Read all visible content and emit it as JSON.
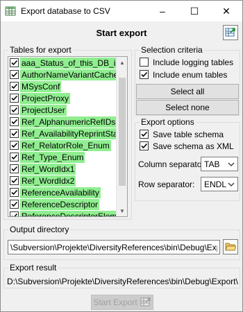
{
  "window": {
    "title": "Export database to CSV",
    "minimize_glyph": "–",
    "maximize_glyph": "☐",
    "close_glyph": "✕"
  },
  "heading": "Start export",
  "tables_group": {
    "legend": "Tables for export",
    "items": [
      {
        "label": "aaa_Status_of_this_DB_is_P",
        "checked": true
      },
      {
        "label": "AuthorNameVariantCache",
        "checked": true
      },
      {
        "label": "MSysConf",
        "checked": true
      },
      {
        "label": "ProjectProxy",
        "checked": true
      },
      {
        "label": "ProjectUser",
        "checked": true
      },
      {
        "label": "Ref_AlphanumericRefIDsFrom",
        "checked": true
      },
      {
        "label": "Ref_AvailabilityReprintStatus",
        "checked": true
      },
      {
        "label": "Ref_RelatorRole_Enum",
        "checked": true
      },
      {
        "label": "Ref_Type_Enum",
        "checked": true
      },
      {
        "label": "Ref_WordIdx1",
        "checked": true
      },
      {
        "label": "Ref_WordIdx2",
        "checked": true
      },
      {
        "label": "ReferenceAvailability",
        "checked": true
      },
      {
        "label": "ReferenceDescriptor",
        "checked": true
      },
      {
        "label": "ReferenceDescriptorElement",
        "checked": true
      }
    ]
  },
  "criteria_group": {
    "legend": "Selection criteria",
    "include_logging_label": "Include logging tables",
    "include_logging_checked": false,
    "include_enum_label": "Include enum tables",
    "include_enum_checked": true,
    "select_all_label": "Select all",
    "select_none_label": "Select none"
  },
  "options_group": {
    "legend": "Export options",
    "save_schema_label": "Save table schema",
    "save_schema_checked": true,
    "save_schema_xml_label": "Save schema as XML",
    "save_schema_xml_checked": true,
    "column_separator_label": "Column separator:",
    "column_separator_value": "TAB",
    "row_separator_label": "Row separator:",
    "row_separator_value": "ENDL"
  },
  "output_directory": {
    "legend": "Output directory",
    "value": "\\Subversion\\Projekte\\DiversityReferences\\bin\\Debug\\Export\\DiversityReferences_Test"
  },
  "export_result": {
    "legend": "Export result",
    "value": "D:\\Subversion\\Projekte\\DiversityReferences\\bin\\Debug\\Export\\DiversityReferences_Test"
  },
  "start_export_button_label": "Start Export",
  "colors": {
    "selected_table_bg": "#90ee90",
    "window_bg": "#f0f0f0"
  }
}
